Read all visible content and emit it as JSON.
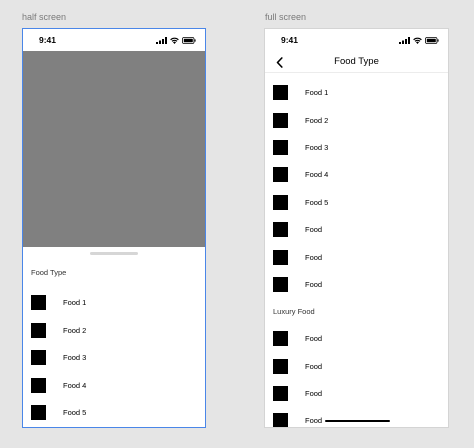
{
  "frames": {
    "half_label": "half screen",
    "full_label": "full screen"
  },
  "status": {
    "time": "9:41"
  },
  "half": {
    "sheet_title": "Food Type",
    "items": [
      {
        "label": "Food 1"
      },
      {
        "label": "Food 2"
      },
      {
        "label": "Food 3"
      },
      {
        "label": "Food 4"
      },
      {
        "label": "Food 5"
      }
    ]
  },
  "full": {
    "nav_title": "Food Type",
    "items": [
      {
        "label": "Food 1"
      },
      {
        "label": "Food 2"
      },
      {
        "label": "Food 3"
      },
      {
        "label": "Food 4"
      },
      {
        "label": "Food 5"
      },
      {
        "label": "Food"
      },
      {
        "label": "Food"
      },
      {
        "label": "Food"
      }
    ],
    "section_title": "Luxury Food",
    "luxury_items": [
      {
        "label": "Food"
      },
      {
        "label": "Food"
      },
      {
        "label": "Food"
      },
      {
        "label": "Food"
      }
    ]
  },
  "colors": {
    "backdrop": "#808080",
    "selection_border": "#4a86e8",
    "thumbnail": "#000000"
  },
  "icons": [
    "signal-icon",
    "wifi-icon",
    "battery-icon",
    "chevron-left-icon"
  ]
}
